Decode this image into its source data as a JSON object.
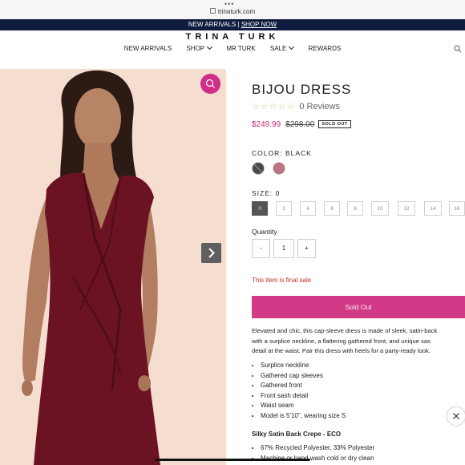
{
  "browser": {
    "url": "trinaturk.com"
  },
  "promo": {
    "text": "NEW ARRIVALS | ",
    "link": "SHOP NOW"
  },
  "header": {
    "brand": "TRINA TURK",
    "nav": [
      "NEW ARRIVALS",
      "SHOP",
      "MR TURK",
      "SALE",
      "REWARDS"
    ]
  },
  "product": {
    "title": "BIJOU DRESS",
    "reviews": "0 Reviews",
    "stars": "☆☆☆☆☆",
    "price_sale": "$249.99",
    "price_original": "$298.00",
    "badge": "SOLD OUT",
    "color_label": "COLOR:",
    "color_value": "BLACK",
    "colors": [
      {
        "name": "black",
        "hex": "#4a4a4a"
      },
      {
        "name": "wine",
        "hex": "#b97786"
      }
    ],
    "size_label": "SIZE:",
    "size_value": "0",
    "sizes": [
      "0",
      "2",
      "4",
      "6",
      "8",
      "10",
      "12",
      "14",
      "16"
    ],
    "quantity_label": "Quantity",
    "quantity_minus": "-",
    "quantity_value": "1",
    "quantity_plus": "+",
    "final_sale": "This item is final sale",
    "cta": "Sold Out",
    "description": [
      "Elevated and chic, this cap-sleeve dress is made of sleek, satin-back",
      "with a surplice neckline, a flattering gathered front, and unique sas",
      "detail at the waist. Pair this dress with heels for a party-ready look."
    ],
    "features": [
      "Surplice neckline",
      "Gathered cap sleeves",
      "Gathered front",
      "Front sash detail",
      "Waist seam",
      "Model is 5'10\", wearing size S"
    ],
    "material_heading": "Silky Satin Back Crepe - ECO",
    "material": [
      "67% Recycled Polyester, 33% Polyester",
      "Machine or hand wash cold or dry clean"
    ]
  },
  "colors": {
    "accent": "#cf2f86",
    "sale_price": "#c02a76",
    "promo_bg": "#0f1c3f",
    "final_sale": "#c42e2e"
  }
}
